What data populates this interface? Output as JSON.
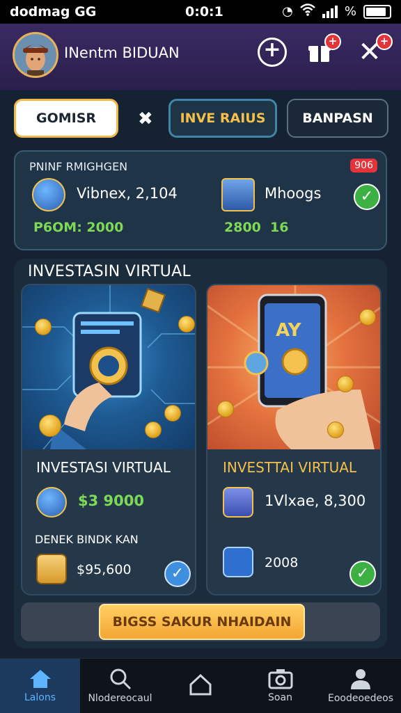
{
  "status_bar": {
    "left_text": "dodmag",
    "network": "GG",
    "time": "0:0:1",
    "battery_label": "%"
  },
  "header": {
    "username": "INentm BIDUAN",
    "icons": [
      "plus-icon",
      "gift-icon",
      "close-icon"
    ]
  },
  "tabs": {
    "tab1": "GOMISR",
    "tab2": "INVE RAIUS",
    "tab3": "BANPASN"
  },
  "summary": {
    "title": "PNINF RMIGHGEN",
    "badge": "906",
    "left_value": "Vibnex, 2,104",
    "left_sub": "P6OM: 2000",
    "right_value": "Mhoogs",
    "right_sub_a": "2800",
    "right_sub_b": "16"
  },
  "investment": {
    "section_title": "INVESTASIN VIRTUAL",
    "card1": {
      "title": "INVESTASI VIRTUAL",
      "value": "$3 9000",
      "subhead": "DENEK BINDK KAN",
      "amount": "$95,600"
    },
    "card2": {
      "title": "INVESTTAI VIRTUAL",
      "phone_text": "AY",
      "value": "1Vlxae, 8,300",
      "amount": "2008"
    },
    "cta_label": "BIGSS SAKUR NHAIDAIN"
  },
  "bottom_nav": {
    "items": [
      {
        "label": "Lalons",
        "icon": "home-icon"
      },
      {
        "label": "Nlodereocaul",
        "icon": "search-icon"
      },
      {
        "label": "",
        "icon": "house-icon"
      },
      {
        "label": "Soan",
        "icon": "camera-icon"
      },
      {
        "label": "Eoodeoedeos",
        "icon": "profile-icon"
      }
    ]
  },
  "colors": {
    "accent_gold": "#f5c04a",
    "accent_green": "#7ed957",
    "header_bg": "#3a2a63",
    "nav_active": "#5fb4ff"
  }
}
